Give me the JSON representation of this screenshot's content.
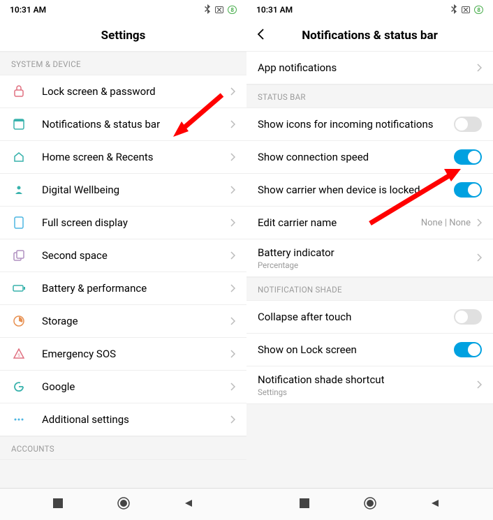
{
  "status": {
    "time": "10:31 AM",
    "battery": "8"
  },
  "left": {
    "title": "Settings",
    "section1": "SYSTEM & DEVICE",
    "section2": "ACCOUNTS",
    "items": [
      {
        "label": "Lock screen & password"
      },
      {
        "label": "Notifications & status bar"
      },
      {
        "label": "Home screen & Recents"
      },
      {
        "label": "Digital Wellbeing"
      },
      {
        "label": "Full screen display"
      },
      {
        "label": "Second space"
      },
      {
        "label": "Battery & performance"
      },
      {
        "label": "Storage"
      },
      {
        "label": "Emergency SOS"
      },
      {
        "label": "Google"
      },
      {
        "label": "Additional settings"
      }
    ]
  },
  "right": {
    "title": "Notifications & status bar",
    "appNotifications": "App notifications",
    "section1": "STATUS BAR",
    "showIcons": "Show icons for incoming notifications",
    "showSpeed": "Show connection speed",
    "showCarrier": "Show carrier when device is locked",
    "editCarrier": "Edit carrier name",
    "editCarrierValue": "None | None",
    "batteryIndicator": "Battery indicator",
    "batteryIndicatorSub": "Percentage",
    "section2": "NOTIFICATION SHADE",
    "collapseTouch": "Collapse after touch",
    "showLock": "Show on Lock screen",
    "shadeShortcut": "Notification shade shortcut",
    "shadeShortcutSub": "Settings"
  }
}
